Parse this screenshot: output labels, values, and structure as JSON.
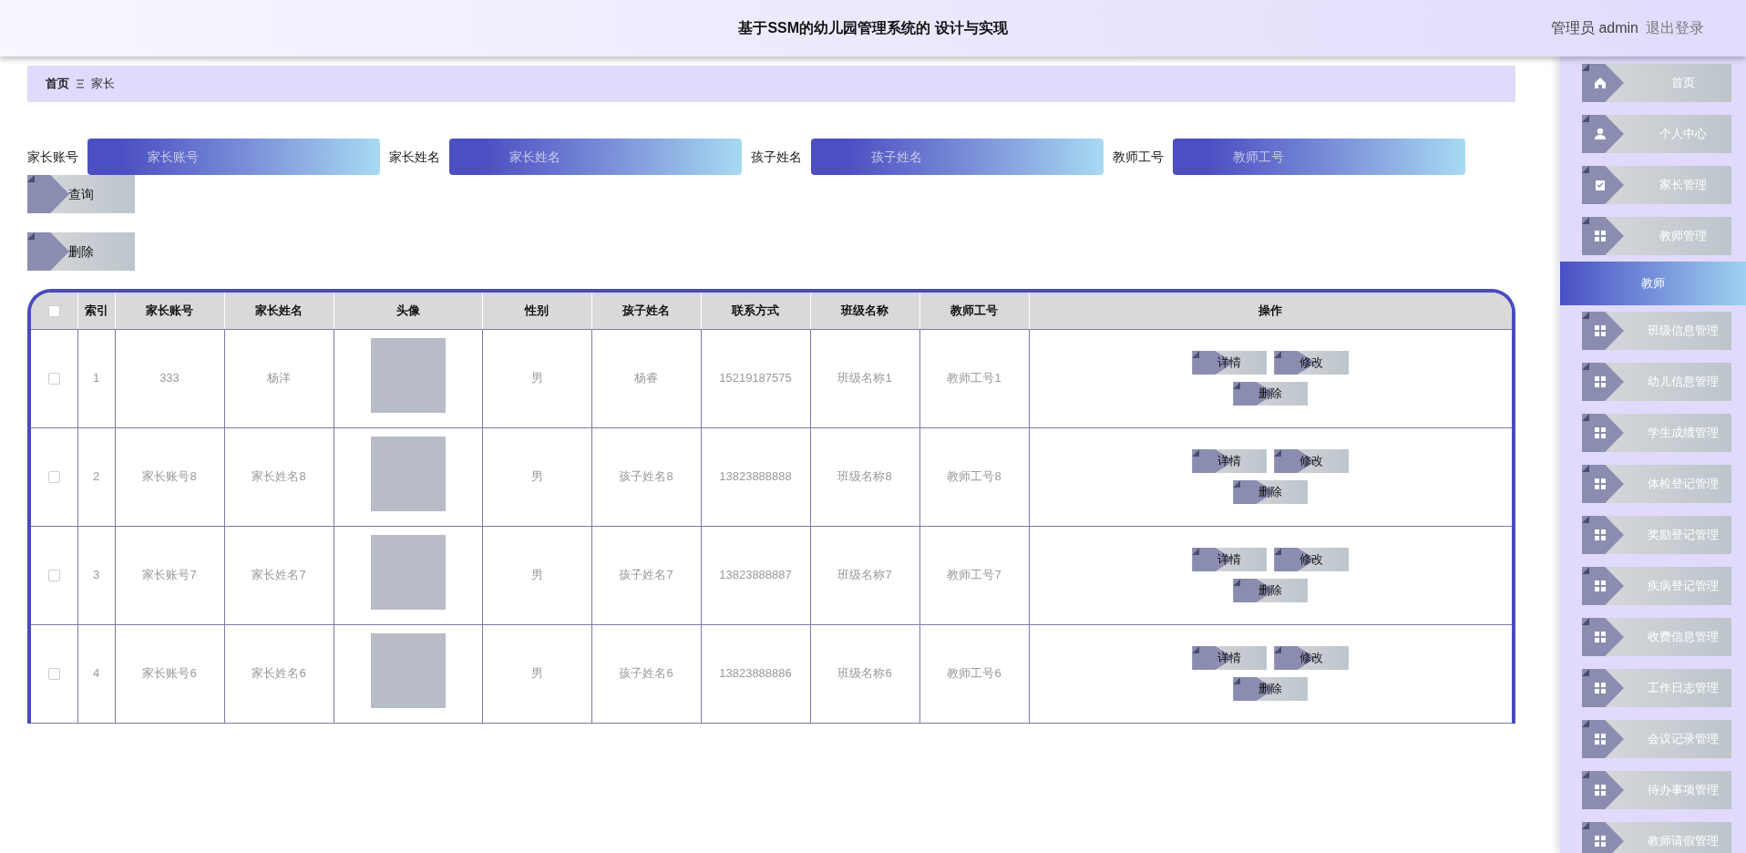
{
  "header": {
    "title": "基于SSM的幼儿园管理系统的 设计与实现",
    "user": "管理员 admin",
    "logout": "退出登录"
  },
  "breadcrumb": {
    "home": "首页",
    "current": "家长"
  },
  "search": {
    "fields": [
      {
        "label": "家长账号",
        "placeholder": "家长账号"
      },
      {
        "label": "家长姓名",
        "placeholder": "家长姓名"
      },
      {
        "label": "孩子姓名",
        "placeholder": "孩子姓名"
      },
      {
        "label": "教师工号",
        "placeholder": "教师工号"
      }
    ],
    "query_button": "查询"
  },
  "delete_button": "删除",
  "table": {
    "select_all_checked": false,
    "columns": [
      "索引",
      "家长账号",
      "家长姓名",
      "头像",
      "性别",
      "孩子姓名",
      "联系方式",
      "班级名称",
      "教师工号",
      "操作"
    ],
    "rows": [
      {
        "checked": false,
        "cells": [
          "1",
          "333",
          "杨洋"
        ],
        "after": [
          "男",
          "杨睿",
          "15219187575",
          "班级名称1",
          "教师工号1"
        ],
        "actions": [
          "详情",
          "修改",
          "删除"
        ]
      },
      {
        "checked": false,
        "cells": [
          "2",
          "家长账号8",
          "家长姓名8"
        ],
        "after": [
          "男",
          "孩子姓名8",
          "13823888888",
          "班级名称8",
          "教师工号8"
        ],
        "actions": [
          "详情",
          "修改",
          "删除"
        ]
      },
      {
        "checked": false,
        "cells": [
          "3",
          "家长账号7",
          "家长姓名7"
        ],
        "after": [
          "男",
          "孩子姓名7",
          "13823888887",
          "班级名称7",
          "教师工号7"
        ],
        "actions": [
          "详情",
          "修改",
          "删除"
        ]
      },
      {
        "checked": false,
        "cells": [
          "4",
          "家长账号6",
          "家长姓名6"
        ],
        "after": [
          "男",
          "孩子姓名6",
          "13823888886",
          "班级名称6",
          "教师工号6"
        ],
        "actions": [
          "详情",
          "修改",
          "删除"
        ]
      }
    ]
  },
  "sidebar": {
    "items": [
      {
        "label": "首页",
        "selected": false
      },
      {
        "label": "个人中心",
        "selected": false
      },
      {
        "label": "家长管理",
        "selected": false
      },
      {
        "label": "教师管理",
        "selected": false,
        "expanded": true,
        "children": [
          {
            "label": "教师",
            "selected": true
          }
        ]
      },
      {
        "label": "班级信息管理",
        "selected": false
      },
      {
        "label": "幼儿信息管理",
        "selected": false
      },
      {
        "label": "学生成绩管理",
        "selected": false
      },
      {
        "label": "体检登记管理",
        "selected": false
      },
      {
        "label": "奖励登记管理",
        "selected": false
      },
      {
        "label": "疾病登记管理",
        "selected": false
      },
      {
        "label": "收费信息管理",
        "selected": false
      },
      {
        "label": "工作日志管理",
        "selected": false
      },
      {
        "label": "会议记录管理",
        "selected": false
      },
      {
        "label": "待办事项管理",
        "selected": false
      },
      {
        "label": "教师请假管理",
        "selected": false
      }
    ]
  }
}
